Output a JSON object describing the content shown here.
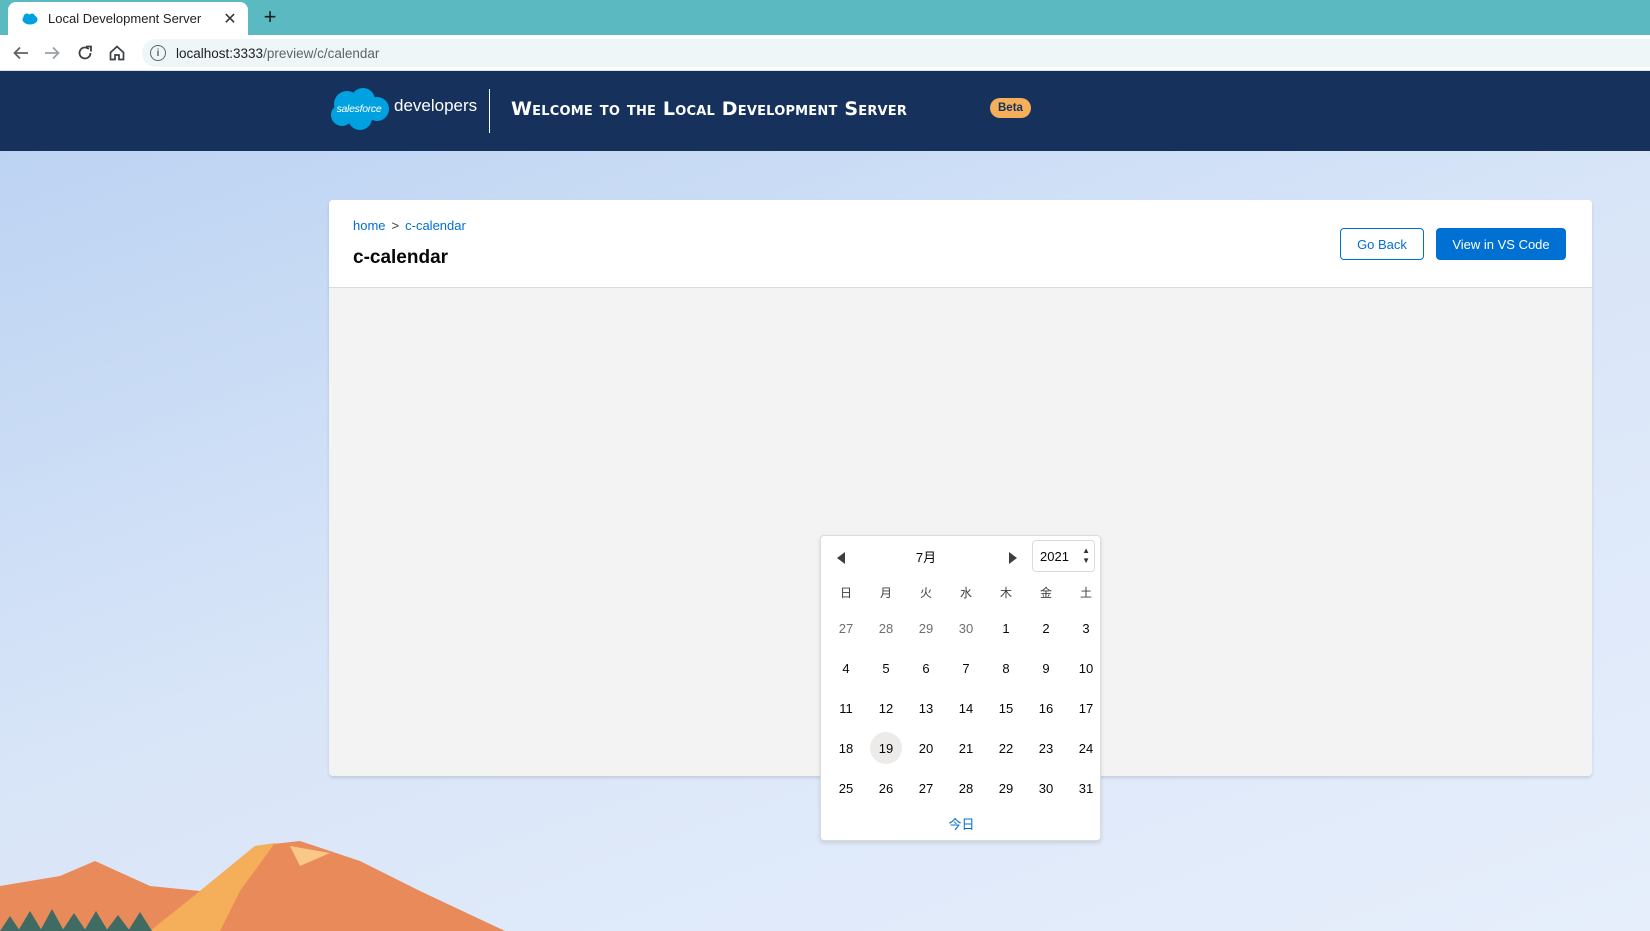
{
  "browser": {
    "tab_title": "Local Development Server",
    "new_tab_symbol": "+",
    "close_symbol": "✕",
    "url_host": "localhost:3333",
    "url_path": "/preview/c/calendar"
  },
  "header": {
    "logo_text": "salesforce",
    "logo_subtext": "developers",
    "title": "Welcome to the Local Development Server",
    "badge": "Beta"
  },
  "page": {
    "breadcrumb": [
      {
        "label": "home"
      },
      {
        "label": "c-calendar"
      }
    ],
    "breadcrumb_separator": ">",
    "title": "c-calendar",
    "go_back_label": "Go Back",
    "vscode_label": "View in VS Code"
  },
  "datepicker": {
    "month": "7月",
    "year": "2021",
    "weekdays": [
      "日",
      "月",
      "火",
      "水",
      "木",
      "金",
      "土"
    ],
    "weeks": [
      [
        {
          "d": "27",
          "m": true
        },
        {
          "d": "28",
          "m": true
        },
        {
          "d": "29",
          "m": true
        },
        {
          "d": "30",
          "m": true
        },
        {
          "d": "1"
        },
        {
          "d": "2"
        },
        {
          "d": "3"
        }
      ],
      [
        {
          "d": "4"
        },
        {
          "d": "5"
        },
        {
          "d": "6"
        },
        {
          "d": "7"
        },
        {
          "d": "8"
        },
        {
          "d": "9"
        },
        {
          "d": "10"
        }
      ],
      [
        {
          "d": "11"
        },
        {
          "d": "12"
        },
        {
          "d": "13"
        },
        {
          "d": "14"
        },
        {
          "d": "15"
        },
        {
          "d": "16"
        },
        {
          "d": "17"
        }
      ],
      [
        {
          "d": "18"
        },
        {
          "d": "19",
          "today": true
        },
        {
          "d": "20"
        },
        {
          "d": "21"
        },
        {
          "d": "22"
        },
        {
          "d": "23"
        },
        {
          "d": "24"
        }
      ],
      [
        {
          "d": "25"
        },
        {
          "d": "26"
        },
        {
          "d": "27"
        },
        {
          "d": "28"
        },
        {
          "d": "29"
        },
        {
          "d": "30"
        },
        {
          "d": "31"
        }
      ]
    ],
    "today_label": "今日"
  },
  "colors": {
    "tabbar": "#5ab9c1",
    "header_bg": "#16325c",
    "brand": "#0070d2",
    "beta_badge": "#f5ae5a"
  }
}
